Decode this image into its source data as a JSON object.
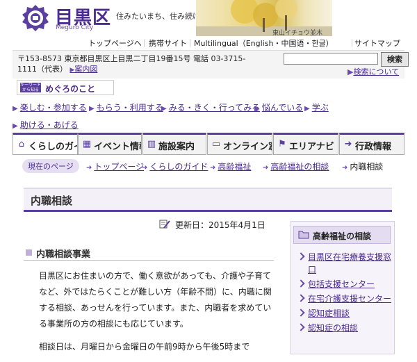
{
  "header": {
    "site_name": "目黒区",
    "site_name_en": "Meguro City",
    "tagline": "住みたいまち、住み続けたいまち 目黒",
    "banner_caption": "東山イチョウ並木"
  },
  "top_nav": {
    "items": [
      "トップページへ",
      "携帯サイト",
      "Multilingual（English・中国语・한글）",
      "サイトマップ"
    ],
    "separator": "｜"
  },
  "address": {
    "text": "〒153-8573 東京都目黒区上目黒二丁目19番15号 電話 03-3715-1111（代表）",
    "map_link": "案内図"
  },
  "search": {
    "placeholder": "",
    "button": "検索",
    "help": "検索について"
  },
  "keyword_box": {
    "badge": "キーワードから知る",
    "label": "めぐろのこと"
  },
  "keyword_links": [
    "楽しむ・参加する",
    "もらう・利用する",
    "みる・きく・行ってみる",
    "悩んでいる",
    "学ぶ",
    "助ける・あげる"
  ],
  "main_nav": [
    {
      "label": "くらしのガイ",
      "icon": "house-icon"
    },
    {
      "label": "イベント情報",
      "icon": "calendar-icon"
    },
    {
      "label": "施設案内",
      "icon": "building-icon"
    },
    {
      "label": "オンライン窓",
      "icon": "monitor-icon"
    },
    {
      "label": "エリアナビ",
      "icon": "signpost-icon"
    },
    {
      "label": "行政情報",
      "icon": "arrow-icon"
    }
  ],
  "breadcrumb": {
    "label": "現在のページ",
    "items": [
      "トップページ",
      "くらしのガイド",
      "高齢福祉",
      "高齢福祉の相談",
      "内職相談"
    ]
  },
  "page": {
    "title": "内職相談",
    "updated": "更新日：2015年4月1日"
  },
  "content": {
    "section_title": "内職相談事業",
    "paragraphs": [
      "目黒区にお住まいの方で、働く意欲があっても、介護や子育てなど、外ではたらくことが難しい方（年齢不問）に、内職に関する相談、あっせんを行っています。また、内職者を求めている事業所の方の相談にも応じています。",
      "相談日は、月曜日から金曜日の午前9時から午後5時まで"
    ]
  },
  "side_panel": {
    "title": "高齢福祉の相談",
    "items": [
      "目黒区在宅療養支援窓口",
      "包括支援センター",
      "在宅介護支援センター",
      "認知症相談",
      "認知症の相談"
    ]
  },
  "colors": {
    "brand": "#4b2c8f",
    "accent": "#5a3ea0",
    "light": "#f3f0f8"
  }
}
